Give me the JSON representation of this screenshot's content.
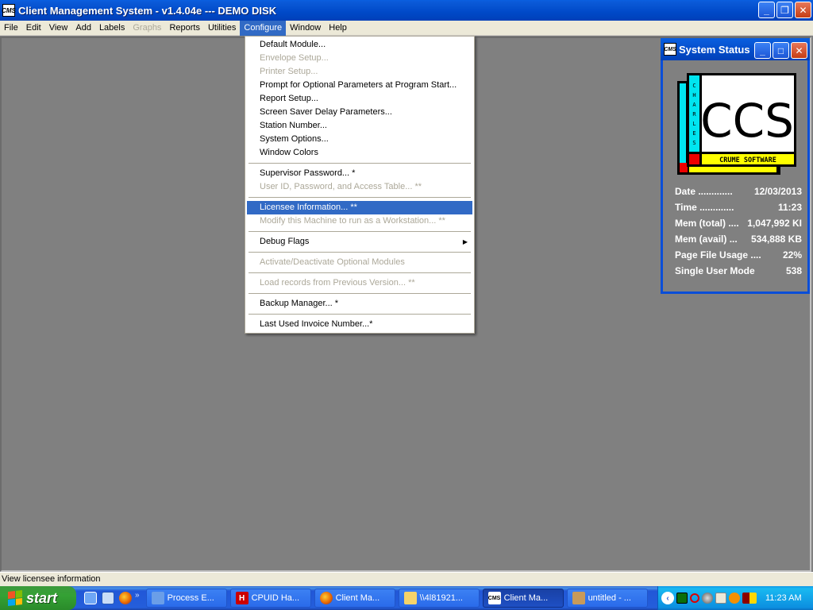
{
  "window": {
    "title": "Client Management System - v1.4.04e --- DEMO DISK",
    "app_icon": "CMS",
    "controls": {
      "minimize": "minimize-icon",
      "restore": "restore-icon",
      "close": "close-icon"
    }
  },
  "menubar": {
    "items": [
      {
        "label": "File",
        "disabled": false
      },
      {
        "label": "Edit",
        "disabled": false
      },
      {
        "label": "View",
        "disabled": false
      },
      {
        "label": "Add",
        "disabled": false
      },
      {
        "label": "Labels",
        "disabled": false
      },
      {
        "label": "Graphs",
        "disabled": true
      },
      {
        "label": "Reports",
        "disabled": false
      },
      {
        "label": "Utilities",
        "disabled": false
      },
      {
        "label": "Configure",
        "disabled": false,
        "active": true
      },
      {
        "label": "Window",
        "disabled": false
      },
      {
        "label": "Help",
        "disabled": false
      }
    ]
  },
  "configure_menu": {
    "groups": [
      [
        {
          "label": "Default Module...",
          "disabled": false
        },
        {
          "label": "Envelope Setup...",
          "disabled": true
        },
        {
          "label": "Printer Setup...",
          "disabled": true
        },
        {
          "label": "Prompt for Optional Parameters at Program Start...",
          "disabled": false
        },
        {
          "label": "Report Setup...",
          "disabled": false
        },
        {
          "label": "Screen Saver Delay Parameters...",
          "disabled": false
        },
        {
          "label": "Station Number...",
          "disabled": false
        },
        {
          "label": "System Options...",
          "disabled": false
        },
        {
          "label": "Window Colors",
          "disabled": false
        }
      ],
      [
        {
          "label": "Supervisor Password... *",
          "disabled": false
        },
        {
          "label": "User ID, Password, and Access Table... **",
          "disabled": true
        }
      ],
      [
        {
          "label": "Licensee Information... **",
          "disabled": false,
          "selected": true
        },
        {
          "label": "Modify this Machine to run as a Workstation... **",
          "disabled": true
        }
      ],
      [
        {
          "label": "Debug Flags",
          "disabled": false,
          "submenu": true
        }
      ],
      [
        {
          "label": "Activate/Deactivate Optional Modules",
          "disabled": true
        }
      ],
      [
        {
          "label": "Load records from Previous Version... **",
          "disabled": true
        }
      ],
      [
        {
          "label": "Backup Manager... *",
          "disabled": false
        }
      ],
      [
        {
          "label": "Last Used Invoice Number...*",
          "disabled": false
        }
      ]
    ]
  },
  "system_status": {
    "title": "System Status",
    "logo": {
      "letters": "CCS",
      "side_text": "CHARLES",
      "bottom_text": "CRUME SOFTWARE"
    },
    "rows": [
      {
        "label": "Date .............",
        "value": "12/03/2013"
      },
      {
        "label": "Time .............",
        "value": "11:23"
      },
      {
        "label": "Mem (total) ....",
        "value": "1,047,992 KI"
      },
      {
        "label": "Mem (avail) ...",
        "value": "534,888 KB"
      },
      {
        "label": "Page File Usage ....",
        "value": "22%"
      },
      {
        "label": "Single User Mode",
        "value": "538"
      }
    ]
  },
  "statusbar": {
    "text": "View licensee information"
  },
  "taskbar": {
    "start_label": "start",
    "quick_launch": [
      "show-desktop-icon",
      "outlook-icon",
      "firefox-icon"
    ],
    "tasks": [
      {
        "label": "Process E...",
        "icon": "process-explorer-icon",
        "active": false
      },
      {
        "label": "CPUID Ha...",
        "icon": "cpuid-icon",
        "active": false
      },
      {
        "label": "Client Ma...",
        "icon": "firefox-icon",
        "active": false
      },
      {
        "label": "\\\\4l81921...",
        "icon": "folder-icon",
        "active": false
      },
      {
        "label": "Client Ma...",
        "icon": "cms-icon",
        "active": true
      },
      {
        "label": "untitled - ...",
        "icon": "paint-icon",
        "active": false
      }
    ],
    "tray_icons": [
      "network-monitor-icon",
      "pen-icon",
      "volume-icon",
      "blank-app-icon",
      "avast-icon",
      "zonealarm-icon"
    ],
    "clock": "11:23 AM"
  }
}
